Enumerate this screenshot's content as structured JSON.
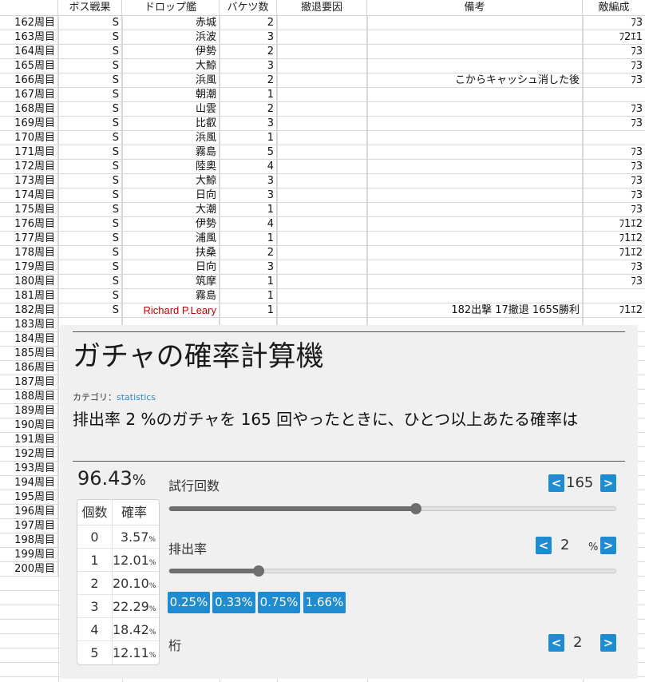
{
  "sheet": {
    "headers": [
      "",
      "ボス戦果",
      "ドロップ艦",
      "バケツ数",
      "撤退要因",
      "備考",
      "敵編成"
    ],
    "rows": [
      [
        "162周目",
        "S",
        "赤城",
        "2",
        "",
        "",
        "ﾌ3"
      ],
      [
        "163周目",
        "S",
        "浜波",
        "3",
        "",
        "",
        "ﾌ2ｴ1"
      ],
      [
        "164周目",
        "S",
        "伊勢",
        "2",
        "",
        "",
        "ﾌ3"
      ],
      [
        "165周目",
        "S",
        "大鯨",
        "3",
        "",
        "",
        "ﾌ3"
      ],
      [
        "166周目",
        "S",
        "浜風",
        "2",
        "",
        "こからキャッシュ消した後",
        "ﾌ3"
      ],
      [
        "167周目",
        "S",
        "朝潮",
        "1",
        "",
        "",
        ""
      ],
      [
        "168周目",
        "S",
        "山雲",
        "2",
        "",
        "",
        "ﾌ3"
      ],
      [
        "169周目",
        "S",
        "比叡",
        "3",
        "",
        "",
        "ﾌ3"
      ],
      [
        "170周目",
        "S",
        "浜風",
        "1",
        "",
        "",
        ""
      ],
      [
        "171周目",
        "S",
        "霧島",
        "5",
        "",
        "",
        "ﾌ3"
      ],
      [
        "172周目",
        "S",
        "陸奥",
        "4",
        "",
        "",
        "ﾌ3"
      ],
      [
        "173周目",
        "S",
        "大鯨",
        "3",
        "",
        "",
        "ﾌ3"
      ],
      [
        "174周目",
        "S",
        "日向",
        "3",
        "",
        "",
        "ﾌ3"
      ],
      [
        "175周目",
        "S",
        "大潮",
        "1",
        "",
        "",
        "ﾌ3"
      ],
      [
        "176周目",
        "S",
        "伊勢",
        "4",
        "",
        "",
        "ﾌ1ｴ2"
      ],
      [
        "177周目",
        "S",
        "浦風",
        "1",
        "",
        "",
        "ﾌ1ｴ2"
      ],
      [
        "178周目",
        "S",
        "扶桑",
        "2",
        "",
        "",
        "ﾌ1ｴ2"
      ],
      [
        "179周目",
        "S",
        "日向",
        "3",
        "",
        "",
        "ﾌ3"
      ],
      [
        "180周目",
        "S",
        "筑摩",
        "1",
        "",
        "",
        "ﾌ3"
      ],
      [
        "181周目",
        "S",
        "霧島",
        "1",
        "",
        "",
        ""
      ],
      [
        "182周目",
        "S",
        "Richard P.Leary",
        "1",
        "",
        "182出撃 17撤退 165S勝利",
        "ﾌ1ｴ2"
      ],
      [
        "183周目",
        "",
        "",
        "",
        "",
        "",
        ""
      ],
      [
        "184周目",
        "",
        "",
        "",
        "",
        "",
        ""
      ],
      [
        "185周目",
        "",
        "",
        "",
        "",
        "",
        ""
      ],
      [
        "186周目",
        "",
        "",
        "",
        "",
        "",
        ""
      ],
      [
        "187周目",
        "",
        "",
        "",
        "",
        "",
        ""
      ],
      [
        "188周目",
        "",
        "",
        "",
        "",
        "",
        ""
      ],
      [
        "189周目",
        "",
        "",
        "",
        "",
        "",
        ""
      ],
      [
        "190周目",
        "",
        "",
        "",
        "",
        "",
        ""
      ],
      [
        "191周目",
        "",
        "",
        "",
        "",
        "",
        ""
      ],
      [
        "192周目",
        "",
        "",
        "",
        "",
        "",
        ""
      ],
      [
        "193周目",
        "",
        "",
        "",
        "",
        "",
        ""
      ],
      [
        "194周目",
        "",
        "",
        "",
        "",
        "",
        ""
      ],
      [
        "195周目",
        "",
        "",
        "",
        "",
        "",
        ""
      ],
      [
        "196周目",
        "",
        "",
        "",
        "",
        "",
        ""
      ],
      [
        "197周目",
        "",
        "",
        "",
        "",
        "",
        ""
      ],
      [
        "198周目",
        "",
        "",
        "",
        "",
        "",
        ""
      ],
      [
        "199周目",
        "",
        "",
        "",
        "",
        "",
        ""
      ],
      [
        "200周目",
        "",
        "",
        "",
        "",
        "",
        ""
      ]
    ],
    "highlight_color": "#c00000"
  },
  "widget": {
    "title": "ガチャの確率計算機",
    "category_label": "カテゴリ：",
    "category_link": "statistics",
    "question": "排出率 2 %のガチャを 165 回やったときに、ひとつ以上あたる確率は",
    "result_value": "96.43",
    "result_unit": "%",
    "table_headers": [
      "個数",
      "確率"
    ],
    "table_rows": [
      [
        "0",
        "3.57",
        "%"
      ],
      [
        "1",
        "12.01",
        "%"
      ],
      [
        "2",
        "20.10",
        "%"
      ],
      [
        "3",
        "22.29",
        "%"
      ],
      [
        "4",
        "18.42",
        "%"
      ],
      [
        "5",
        "12.11",
        "%"
      ]
    ],
    "trials_label": "試行回数",
    "trials_value": "165",
    "trials_slider_fraction": 0.55,
    "rate_label": "排出率",
    "rate_value": "2",
    "rate_unit": "%",
    "rate_slider_fraction": 0.2,
    "rate_presets": [
      "0.25%",
      "0.33%",
      "0.75%",
      "1.66%"
    ],
    "digits_label": "桁",
    "digits_value": "2",
    "btn_prev": "<",
    "btn_next": ">",
    "accent_color": "#1f8bd0"
  }
}
